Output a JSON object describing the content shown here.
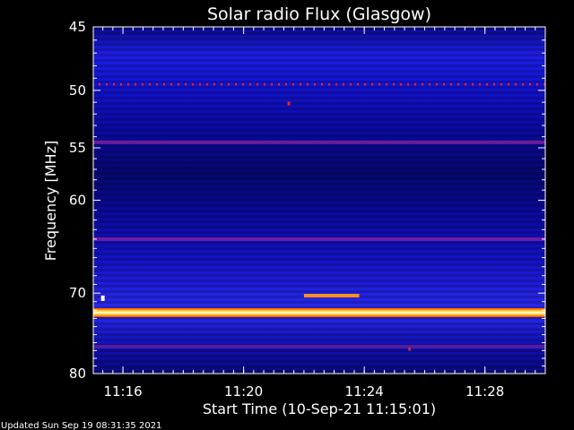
{
  "chart_data": {
    "type": "heatmap",
    "title": "Solar radio Flux (Glasgow)",
    "xlabel": "Start Time (10-Sep-21 11:15:01)",
    "ylabel": "Frequency [MHz]",
    "x_unit": "time (HH:MM)",
    "x_range": [
      "11:15:01",
      "11:30:00"
    ],
    "y_range": [
      45,
      80
    ],
    "y_scale": "log",
    "y_inverted": true,
    "x_ticks": [
      "11:16",
      "11:20",
      "11:24",
      "11:28"
    ],
    "y_ticks": [
      45,
      50,
      55,
      60,
      70,
      80
    ],
    "colormap": [
      "#000050",
      "#0000b4",
      "#1e1eff",
      "#7000b0",
      "#d00040",
      "#ff7000",
      "#ffe000",
      "#ffffff"
    ],
    "background_intensity": "low (blue)",
    "frequency_bands": [
      {
        "freq_mhz": 49.5,
        "intensity": "medium",
        "style": "dotted",
        "color": "#ff2020"
      },
      {
        "freq_mhz": 54.5,
        "intensity": "low-medium",
        "style": "line",
        "color": "#8020a0"
      },
      {
        "freq_mhz": 64.0,
        "intensity": "low-medium",
        "style": "line",
        "color": "#8020a0"
      },
      {
        "freq_mhz": 72.3,
        "intensity": "very high",
        "style": "line",
        "color": "#ffffff"
      },
      {
        "freq_mhz": 76.5,
        "intensity": "low",
        "style": "line",
        "color": "#6020a0"
      }
    ],
    "features": [
      {
        "kind": "burst",
        "start": "11:22:00",
        "end": "11:23:50",
        "freq_mhz": 70.3,
        "intensity": "high",
        "color": "#ff9020"
      },
      {
        "kind": "spot",
        "time": "11:15:20",
        "freq_mhz": 70.6,
        "intensity": "very high",
        "color": "#ffffe0"
      },
      {
        "kind": "spot",
        "time": "11:21:30",
        "freq_mhz": 51.1,
        "intensity": "medium",
        "color": "#ff2020"
      },
      {
        "kind": "spot",
        "time": "11:25:30",
        "freq_mhz": 76.8,
        "intensity": "low",
        "color": "#c02060"
      }
    ],
    "grid": false,
    "legend": "none"
  },
  "footer": {
    "updated": "Updated Sun Sep 19 08:31:35 2021"
  }
}
